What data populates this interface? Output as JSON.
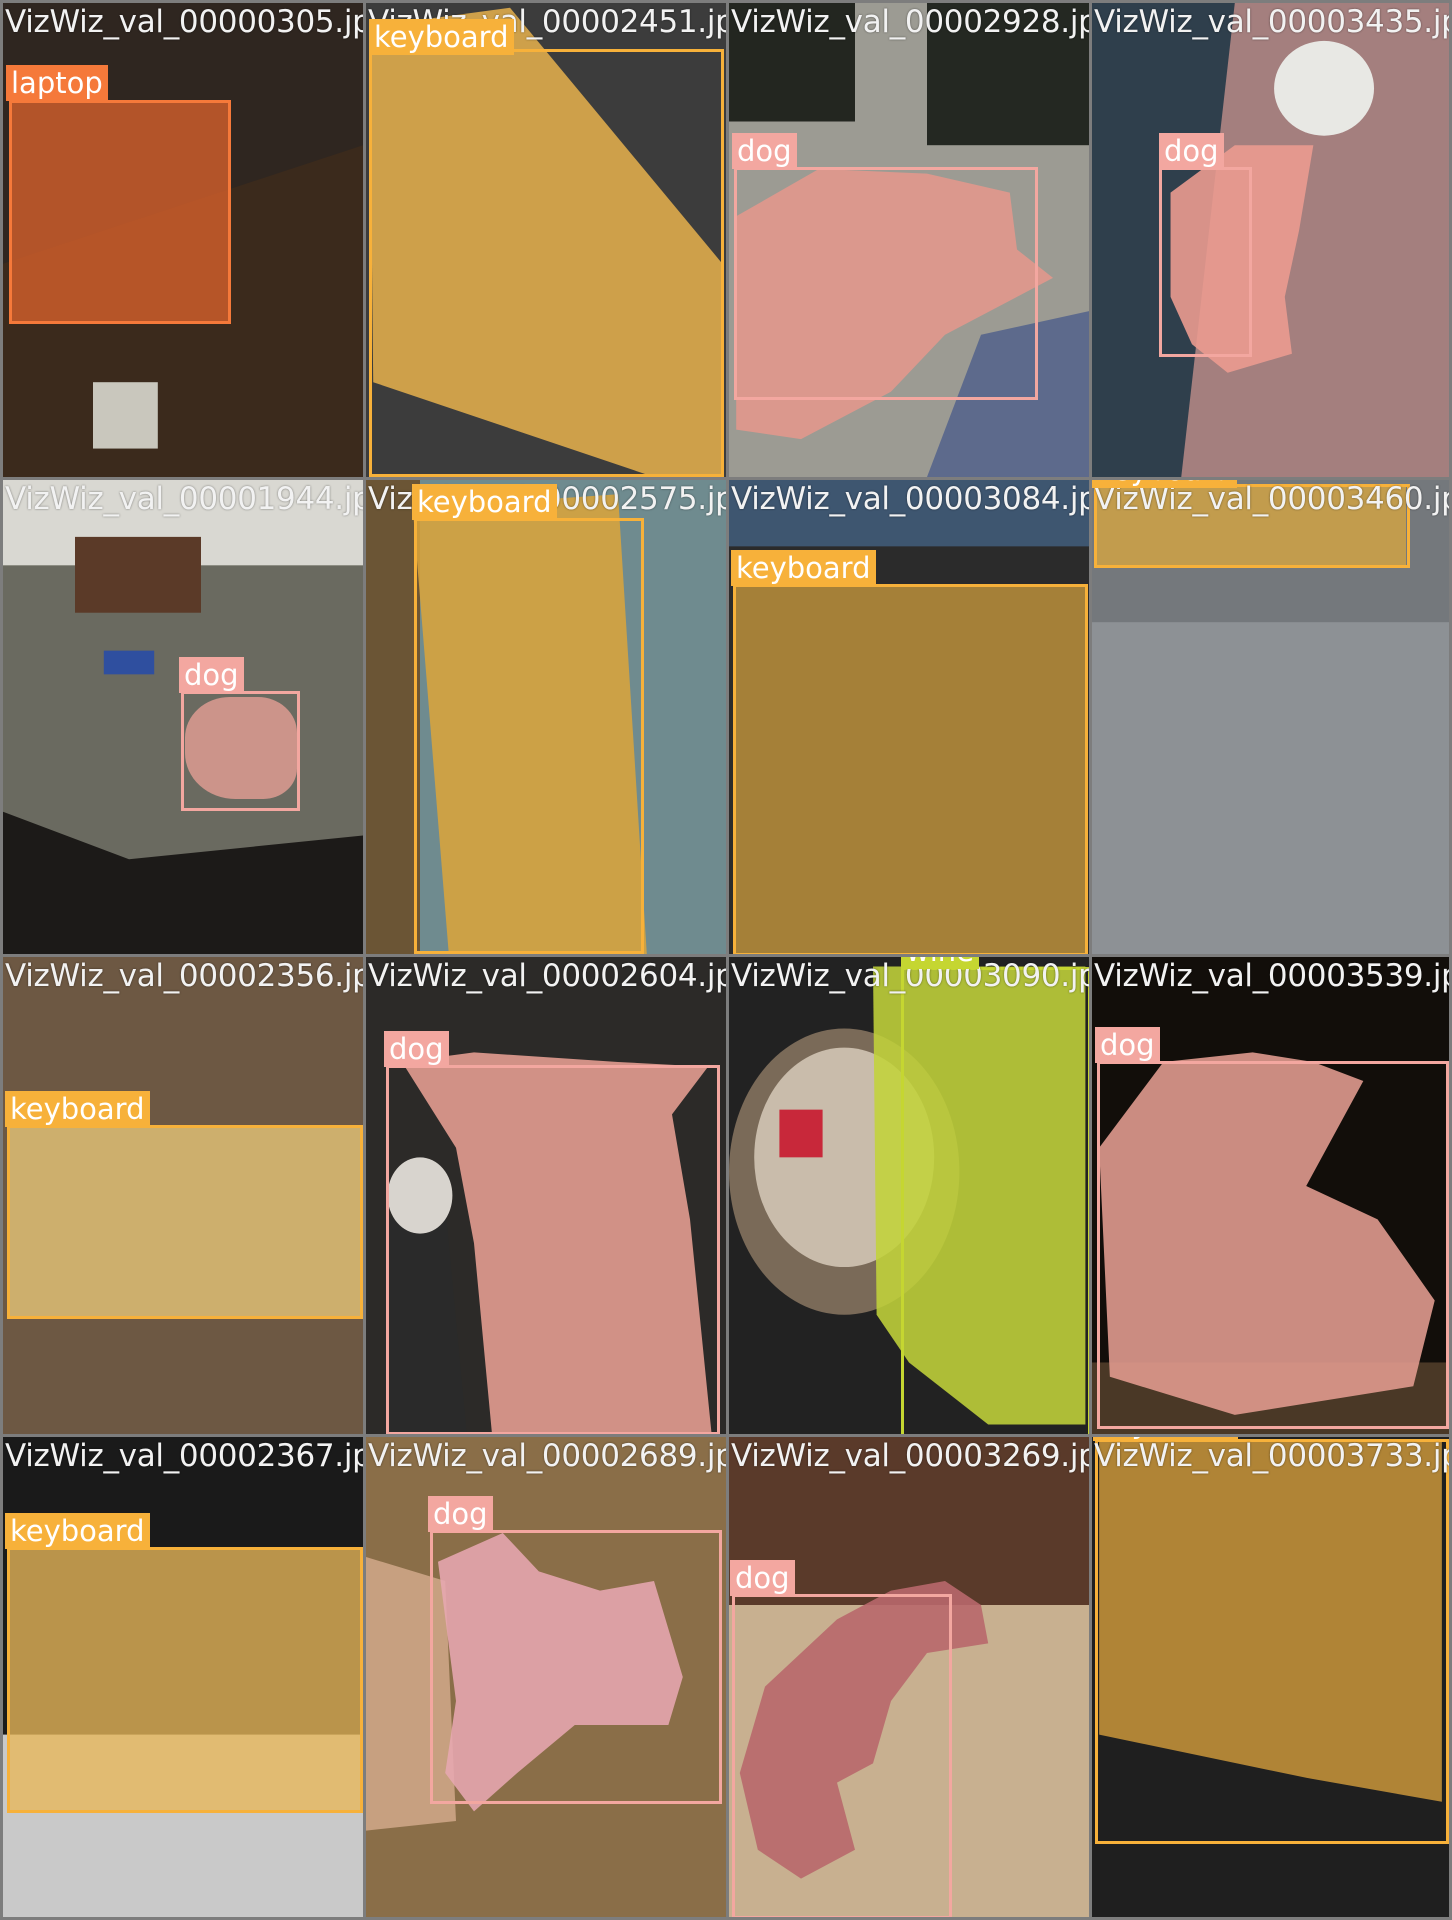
{
  "colors": {
    "laptop": "#f5793a",
    "keyboard": "#f7b13a",
    "dog": "#f3a7a0",
    "wine": "#c5d631"
  },
  "tiles": [
    {
      "file": "VizWiz_val_00000305.jpg",
      "label": "laptop",
      "bg": [
        "#3a2f26",
        "#2a2018"
      ]
    },
    {
      "file": "VizWiz_val_00002451.jpg",
      "label": "keyboard",
      "bg": [
        "#4a4a4a",
        "#2d2d2d"
      ]
    },
    {
      "file": "VizWiz_val_00002928.jpg",
      "label": "dog",
      "bg": [
        "#3b3f2a",
        "#8f8f86"
      ]
    },
    {
      "file": "VizWiz_val_00003435.jpg",
      "label": "dog",
      "bg": [
        "#3b4a55",
        "#9b7a7a"
      ]
    },
    {
      "file": "VizWiz_val_00001944.jpg",
      "label": "dog",
      "bg": [
        "#4a4a44",
        "#6a6a62"
      ]
    },
    {
      "file": "VizWiz_val_00002575.jpg",
      "label": "keyboard",
      "bg": [
        "#6b5535",
        "#6d8a8e"
      ]
    },
    {
      "file": "VizWiz_val_00003084.jpg",
      "label": "keyboard",
      "bg": [
        "#3f4a5a",
        "#2b2b2b"
      ]
    },
    {
      "file": "VizWiz_val_00003460.jpg",
      "label": "keyboard",
      "bg": [
        "#5a5c60",
        "#8a8e92"
      ]
    },
    {
      "file": "VizWiz_val_00002356.jpg",
      "label": "keyboard",
      "bg": [
        "#7a6348",
        "#5b4630"
      ]
    },
    {
      "file": "VizWiz_val_00002604.jpg",
      "label": "dog",
      "bg": [
        "#3a3530",
        "#2c2a28"
      ]
    },
    {
      "file": "VizWiz_val_00003090.jpg",
      "label": "wine",
      "bg": [
        "#2b2b2b",
        "#1a1a1a"
      ]
    },
    {
      "file": "VizWiz_val_00003539.jpg",
      "label": "dog",
      "bg": [
        "#1a1410",
        "#3a2c1e"
      ]
    },
    {
      "file": "VizWiz_val_00002367.jpg",
      "label": "keyboard",
      "bg": [
        "#1c1c1c",
        "#4a4a4a"
      ]
    },
    {
      "file": "VizWiz_val_00002689.jpg",
      "label": "dog",
      "bg": [
        "#8a6e48",
        "#6f5638"
      ]
    },
    {
      "file": "VizWiz_val_00003269.jpg",
      "label": "dog",
      "bg": [
        "#5a3a2a",
        "#c8b090"
      ]
    },
    {
      "file": "VizWiz_val_00003733.jpg",
      "label": "keyboard",
      "bg": [
        "#2a2a2a",
        "#1e1e1e"
      ]
    }
  ]
}
